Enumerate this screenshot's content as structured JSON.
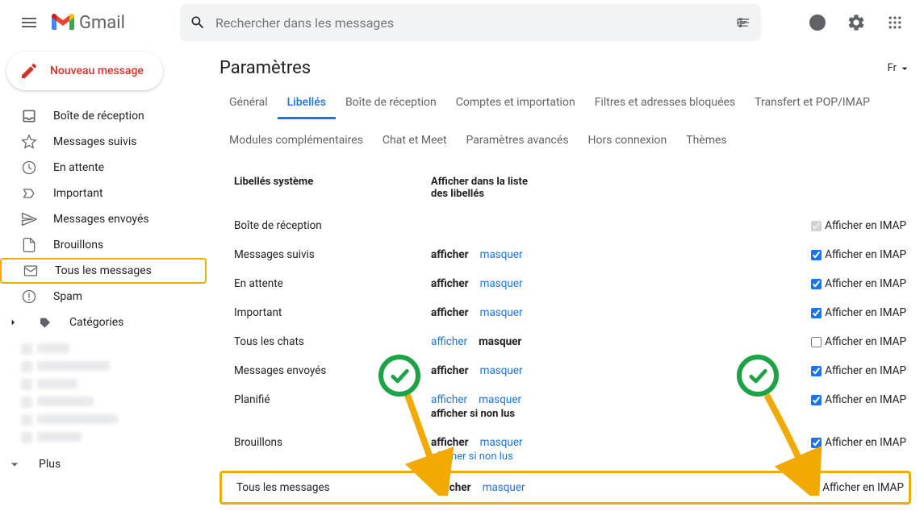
{
  "header": {
    "brand": "Gmail",
    "search_placeholder": "Rechercher dans les messages"
  },
  "compose_label": "Nouveau message",
  "sidebar": {
    "items": [
      {
        "label": "Boîte de réception",
        "icon": "inbox"
      },
      {
        "label": "Messages suivis",
        "icon": "star"
      },
      {
        "label": "En attente",
        "icon": "clock"
      },
      {
        "label": "Important",
        "icon": "important"
      },
      {
        "label": "Messages envoyés",
        "icon": "send"
      },
      {
        "label": "Brouillons",
        "icon": "draft"
      },
      {
        "label": "Tous les messages",
        "icon": "mail"
      },
      {
        "label": "Spam",
        "icon": "spam"
      },
      {
        "label": "Catégories",
        "icon": "tag"
      }
    ],
    "more": "Plus"
  },
  "settings": {
    "title": "Paramètres",
    "lang": "Fr",
    "tabs": [
      "Général",
      "Libellés",
      "Boîte de réception",
      "Comptes et importation",
      "Filtres et adresses bloquées",
      "Transfert et POP/IMAP",
      "Modules complémentaires",
      "Chat et Meet",
      "Paramètres avancés",
      "Hors connexion",
      "Thèmes"
    ],
    "active_tab": 1,
    "columns": {
      "name": "Libellés système",
      "show": "Afficher dans la liste des libellés",
      "imap": "Afficher en IMAP"
    },
    "show_word": "afficher",
    "hide_word": "masquer",
    "unread_word": "afficher si non lus",
    "rows": [
      {
        "name": "Boîte de réception",
        "show": null,
        "hide": null,
        "bold": null,
        "imap": true,
        "imap_disabled": true
      },
      {
        "name": "Messages suivis",
        "bold": "show",
        "imap": true
      },
      {
        "name": "En attente",
        "bold": "show",
        "imap": true
      },
      {
        "name": "Important",
        "bold": "show",
        "imap": true
      },
      {
        "name": "Tous les chats",
        "bold": "hide",
        "imap": false
      },
      {
        "name": "Messages envoyés",
        "bold": "show",
        "imap": true
      },
      {
        "name": "Planifié",
        "bold": null,
        "unread": true,
        "imap": true
      },
      {
        "name": "Brouillons",
        "bold": "show",
        "unread": true,
        "imap": true
      },
      {
        "name": "Tous les messages",
        "bold": "show",
        "imap": true,
        "highlight": true
      }
    ]
  }
}
